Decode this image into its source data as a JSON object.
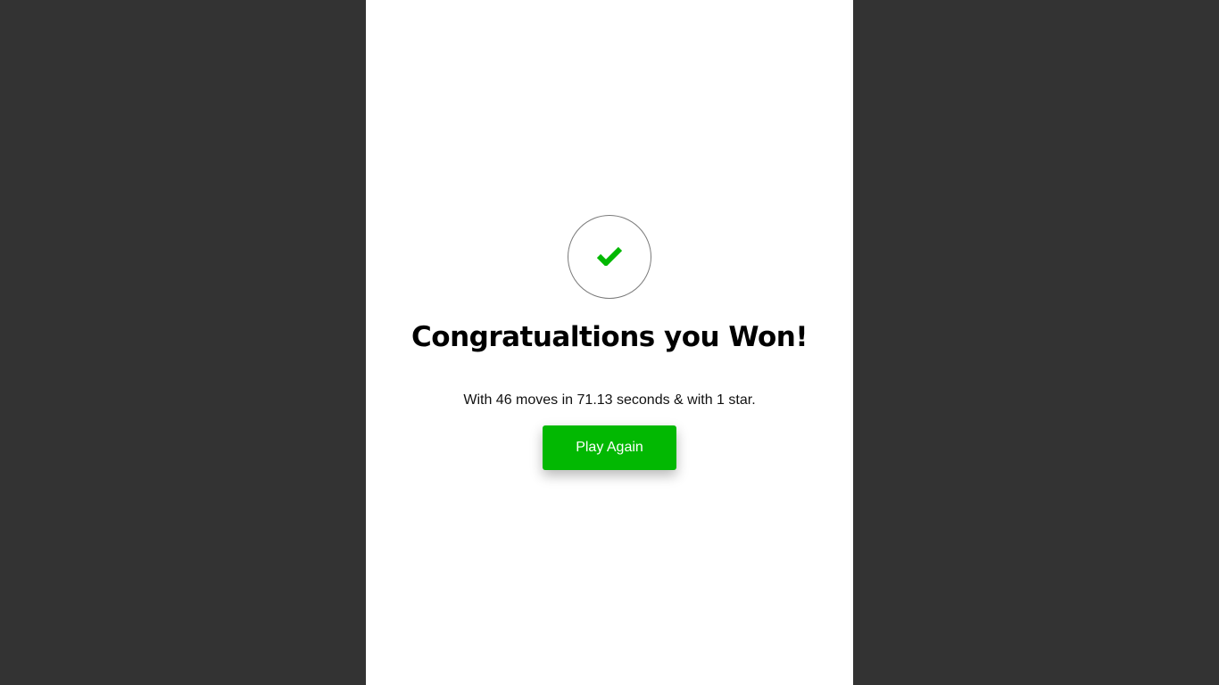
{
  "modal": {
    "icon": "checkmark-icon",
    "title": "Congratualtions you Won!",
    "result_text": "With 46 moves in 71.13 seconds & with 1 star.",
    "moves": 46,
    "seconds": 71.13,
    "stars": 1,
    "play_again_label": "Play Again"
  },
  "colors": {
    "page_background": "#333333",
    "panel_background": "#ffffff",
    "accent_green": "#02b802",
    "title_text": "#000000"
  }
}
